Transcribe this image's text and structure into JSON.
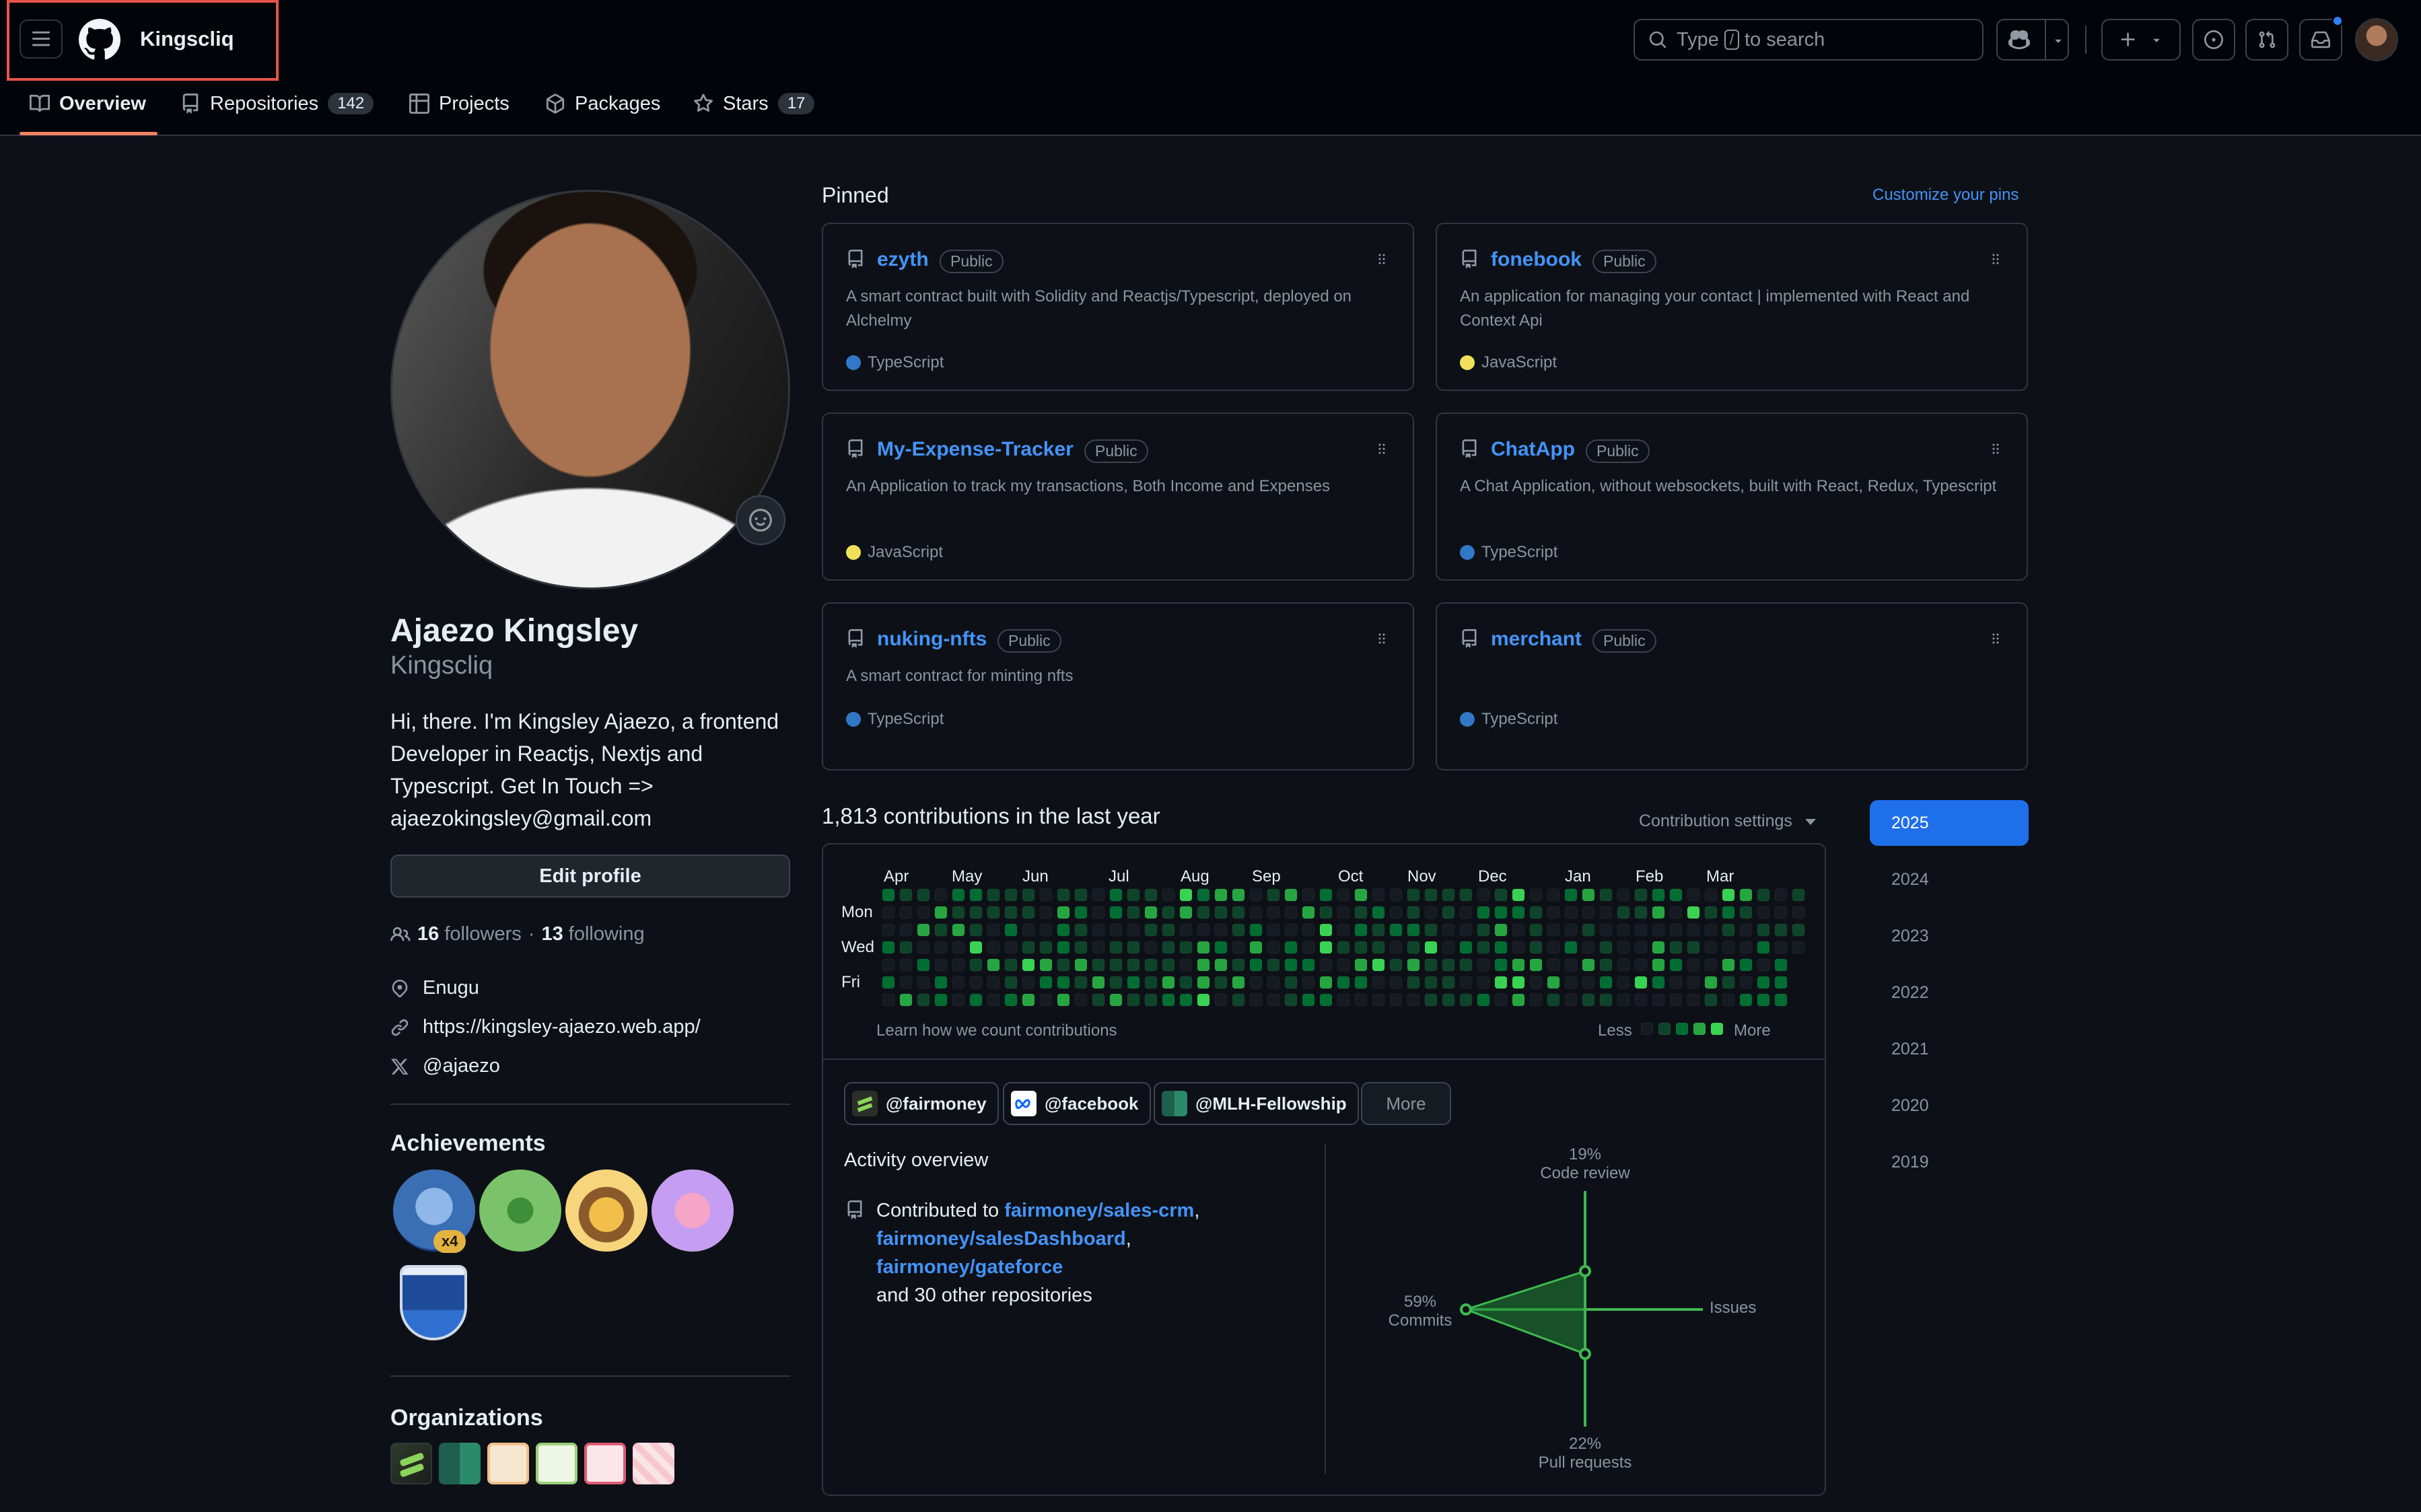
{
  "header": {
    "username": "Kingscliq",
    "search_placeholder_prefix": "Type",
    "search_key": "/",
    "search_placeholder_suffix": "to search"
  },
  "tabs": [
    {
      "label": "Overview",
      "icon": "book-icon",
      "active": true
    },
    {
      "label": "Repositories",
      "count": "142",
      "icon": "repo-icon"
    },
    {
      "label": "Projects",
      "icon": "table-icon"
    },
    {
      "label": "Packages",
      "icon": "package-icon"
    },
    {
      "label": "Stars",
      "count": "17",
      "icon": "star-icon"
    }
  ],
  "profile": {
    "full_name": "Ajaezo Kingsley",
    "login": "Kingscliq",
    "bio": "Hi, there. I'm Kingsley Ajaezo, a frontend Developer in Reactjs, Nextjs and Typescript. Get In Touch => ajaezokingsley@gmail.com",
    "edit_label": "Edit profile",
    "followers": "16",
    "followers_label": "followers",
    "separator": "·",
    "following": "13",
    "following_label": "following",
    "location": "Enugu",
    "website": "https://kingsley-ajaezo.web.app/",
    "twitter": "@ajaezo"
  },
  "achievements": {
    "title": "Achievements",
    "multiplier": "x4"
  },
  "organizations": {
    "title": "Organizations"
  },
  "pinned": {
    "title": "Pinned",
    "customize_label": "Customize your pins",
    "repos": [
      {
        "name": "ezyth",
        "visibility": "Public",
        "description": "A smart contract built with Solidity and Reactjs/Typescript, deployed on Alchelmy",
        "language": "TypeScript",
        "lang_color": "#3178c6"
      },
      {
        "name": "fonebook",
        "visibility": "Public",
        "description": "An application for managing your contact | implemented with React and Context Api",
        "language": "JavaScript",
        "lang_color": "#f1e05a"
      },
      {
        "name": "My-Expense-Tracker",
        "visibility": "Public",
        "description": "An Application to track my transactions, Both Income and Expenses",
        "language": "JavaScript",
        "lang_color": "#f1e05a"
      },
      {
        "name": "ChatApp",
        "visibility": "Public",
        "description": "A Chat Application, without websockets, built with React, Redux, Typescript",
        "language": "TypeScript",
        "lang_color": "#3178c6"
      },
      {
        "name": "nuking-nfts",
        "visibility": "Public",
        "description": "A smart contract for minting nfts",
        "language": "TypeScript",
        "lang_color": "#3178c6"
      },
      {
        "name": "merchant",
        "visibility": "Public",
        "description": "",
        "language": "TypeScript",
        "lang_color": "#3178c6"
      }
    ]
  },
  "contributions": {
    "title": "1,813 contributions in the last year",
    "settings_label": "Contribution settings",
    "months": [
      "Apr",
      "May",
      "Jun",
      "Jul",
      "Aug",
      "Sep",
      "Oct",
      "Nov",
      "Dec",
      "Jan",
      "Feb",
      "Mar"
    ],
    "day_labels": [
      "Mon",
      "Wed",
      "Fri"
    ],
    "learn_label": "Learn how we count contributions",
    "less_label": "Less",
    "more_label": "More",
    "level_colors": [
      "#161b22",
      "#0e4429",
      "#006d32",
      "#26a641",
      "#39d353"
    ]
  },
  "activity": {
    "orgs": [
      {
        "label": "@fairmoney",
        "icon": "fairmoney-logo-icon"
      },
      {
        "label": "@facebook",
        "icon": "meta-logo-icon"
      },
      {
        "label": "@MLH-Fellowship",
        "icon": "mlh-logo-icon"
      }
    ],
    "more_label": "More",
    "title": "Activity overview",
    "contributed_to": "Contributed to",
    "repos": [
      "fairmoney/sales-crm",
      "fairmoney/salesDashboard",
      "fairmoney/gateforce"
    ],
    "comma": ",",
    "other": "and 30 other repositories",
    "radar": {
      "code_review_pct": "19%",
      "code_review_label": "Code review",
      "commits_pct": "59%",
      "commits_label": "Commits",
      "pull_requests_pct": "22%",
      "pull_requests_label": "Pull requests",
      "issues_label": "Issues",
      "values": {
        "code_review": 19,
        "commits": 59,
        "pull_requests": 22,
        "issues": 0
      }
    }
  },
  "years": [
    "2025",
    "2024",
    "2023",
    "2022",
    "2021",
    "2020",
    "2019"
  ],
  "active_year": "2025"
}
